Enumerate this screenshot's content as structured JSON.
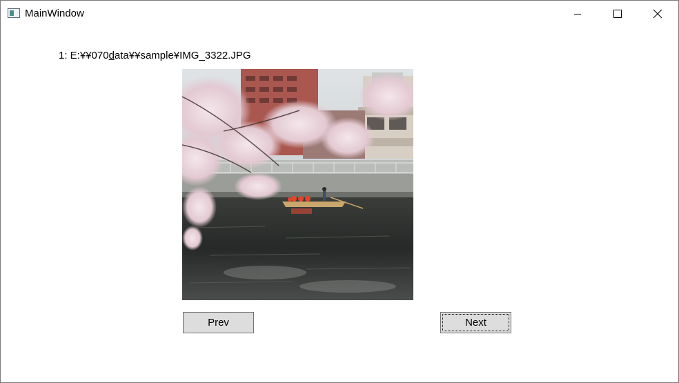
{
  "window": {
    "title": "MainWindow",
    "icon": "app-window-icon",
    "controls": {
      "minimize_icon": "minimize-icon",
      "maximize_icon": "maximize-icon",
      "close_icon": "close-icon"
    }
  },
  "file": {
    "prefix": "1: E:¥¥070",
    "underlined_char": "d",
    "suffix": "ata¥¥sample¥IMG_3322.JPG"
  },
  "photo": {
    "description_icon": "photo-image"
  },
  "buttons": {
    "prev_label": "Prev",
    "next_label": "Next"
  },
  "colors": {
    "button_background": "#dddddd",
    "button_border": "#707070",
    "window_border": "#7a7a7a"
  }
}
